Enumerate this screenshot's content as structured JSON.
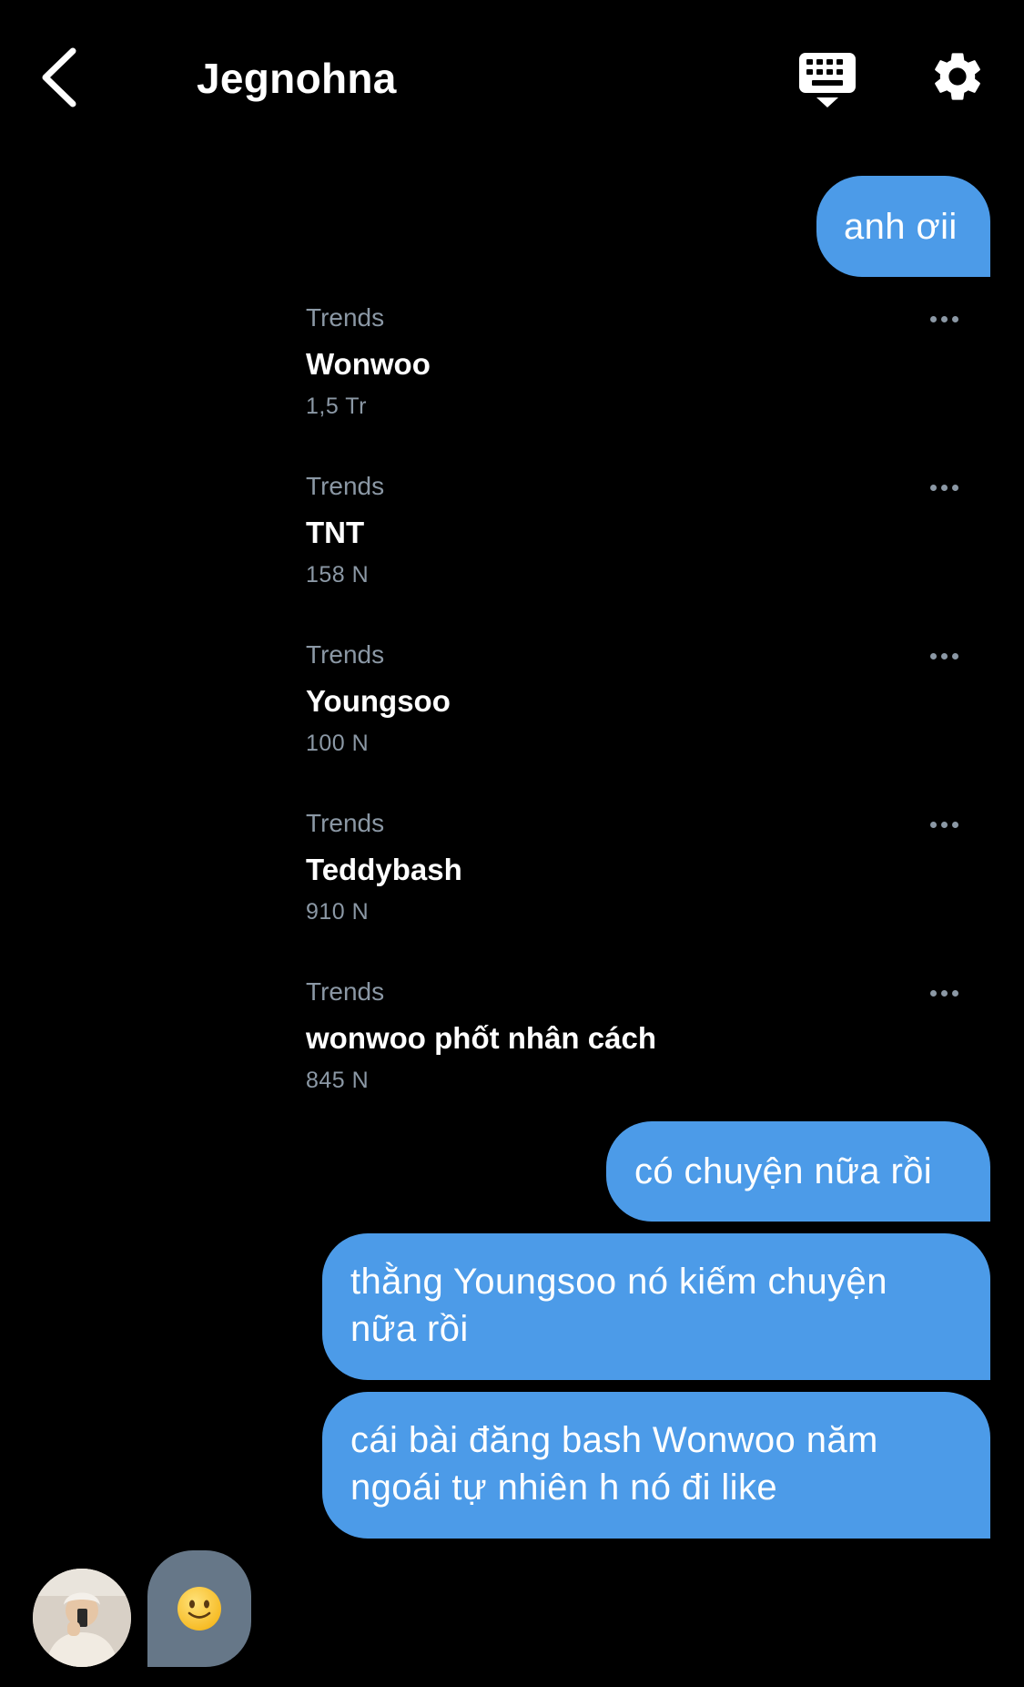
{
  "header": {
    "title": "Jegnohna",
    "back_icon": "chevron-left-icon",
    "keyboard_icon": "keyboard-icon",
    "settings_icon": "gear-icon"
  },
  "messages": [
    {
      "text": "anh ơii"
    },
    {
      "text": "có chuyện nữa rồi"
    },
    {
      "text_lines": [
        "thằng Youngsoo nó kiếm chuyện",
        "nữa rồi"
      ]
    },
    {
      "text_lines": [
        "cái bài đăng bash Wonwoo năm",
        "ngoái tự nhiên h nó đi like"
      ]
    }
  ],
  "trends": [
    {
      "category": "Trends",
      "name": "Wonwoo",
      "count": "1,5 Tr"
    },
    {
      "category": "Trends",
      "name": "TNT",
      "count": "158 N"
    },
    {
      "category": "Trends",
      "name": "Youngsoo",
      "count": "100 N"
    },
    {
      "category": "Trends",
      "name": "Teddybash",
      "count": "910 N"
    },
    {
      "category": "Trends",
      "name": "wonwoo phốt nhân cách",
      "count": "845 N"
    }
  ],
  "typing": {
    "emoji": "slightly-smiling-face-icon"
  },
  "colors": {
    "background": "#000000",
    "bubble_sent": "#4c9be8",
    "bubble_received": "#667788",
    "muted_text": "#8b98a5"
  }
}
